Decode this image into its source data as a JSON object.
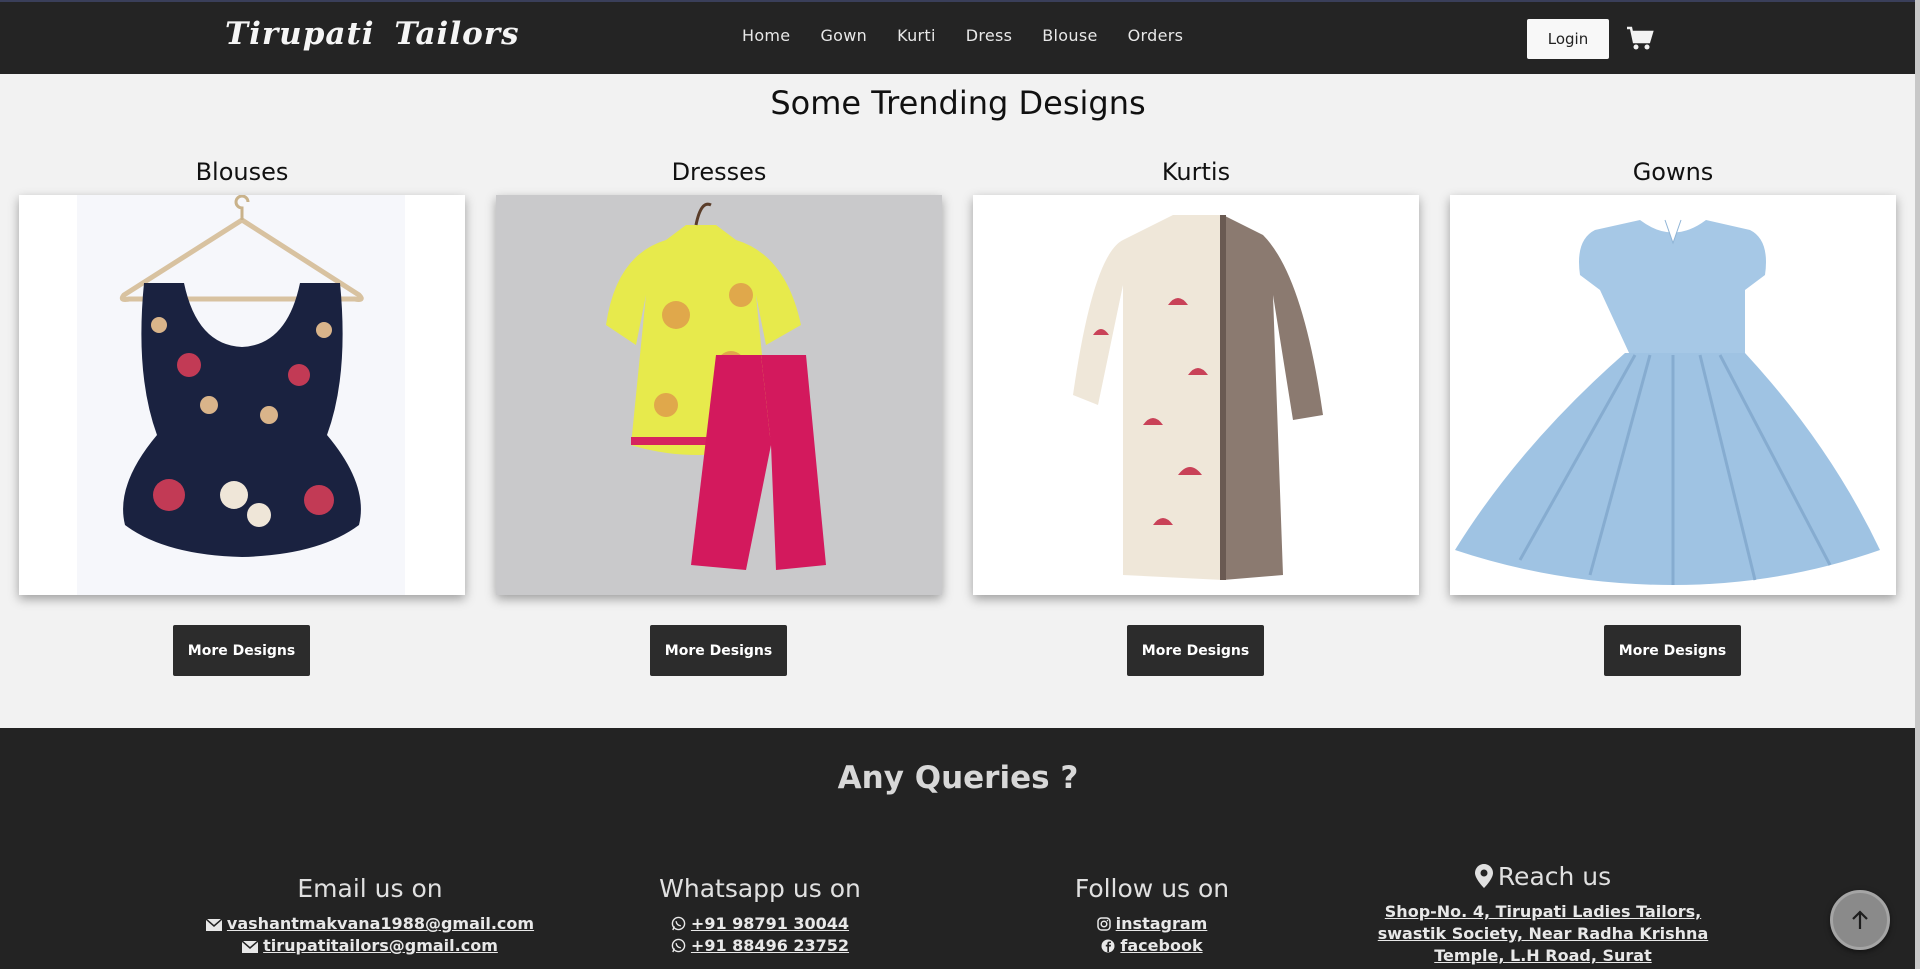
{
  "brand": "Tirupati Tailors",
  "nav": [
    "Home",
    "Gown",
    "Kurti",
    "Dress",
    "Blouse",
    "Orders"
  ],
  "login_label": "Login",
  "section_title": "Some Trending Designs",
  "cards": [
    {
      "title": "Blouses",
      "button": "More Designs",
      "image": "navy floral peplum blouse on hanger"
    },
    {
      "title": "Dresses",
      "button": "More Designs",
      "image": "yellow kurti with pink palazzo"
    },
    {
      "title": "Kurtis",
      "button": "More Designs",
      "image": "umbrella print kurti with checked panel"
    },
    {
      "title": "Gowns",
      "button": "More Designs",
      "image": "light blue flared gown"
    }
  ],
  "footer": {
    "title": "Any Queries ?",
    "email": {
      "heading": "Email us on",
      "items": [
        "vashantmakvana1988@gmail.com",
        "tirupatitailors@gmail.com"
      ]
    },
    "whatsapp": {
      "heading": "Whatsapp us on",
      "items": [
        "+91 98791 30044",
        "+91 88496 23752"
      ]
    },
    "follow": {
      "heading": "Follow us on",
      "items": [
        "instagram",
        "facebook"
      ]
    },
    "reach": {
      "heading": "Reach us",
      "address": "Shop-No. 4, Tirupati Ladies Tailors, swastik Society, Near Radha Krishna Temple, L.H Road, Surat"
    }
  },
  "icons": [
    "cart-icon",
    "envelope-icon",
    "whatsapp-icon",
    "instagram-icon",
    "facebook-icon",
    "map-pin-icon",
    "arrow-up-icon"
  ]
}
